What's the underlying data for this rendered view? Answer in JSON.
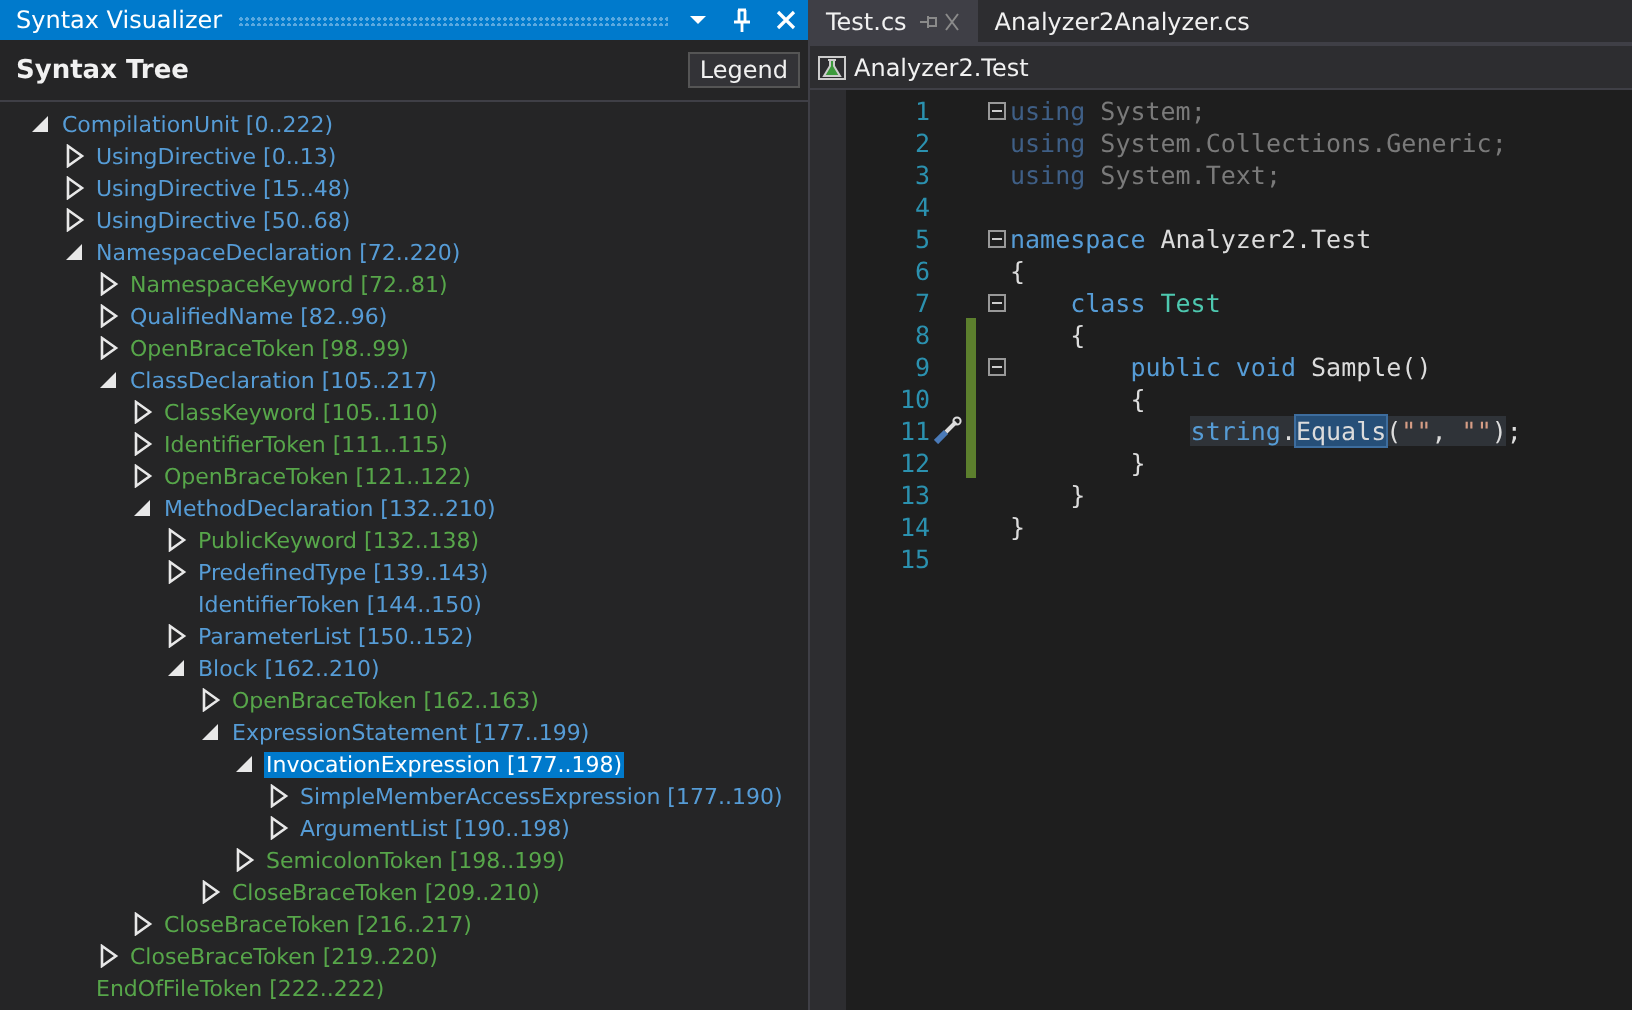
{
  "tool_window": {
    "title": "Syntax Visualizer",
    "header": "Syntax Tree",
    "legend_button": "Legend",
    "tree": [
      {
        "label": "CompilationUnit [0..222)",
        "kind": "node",
        "expanded": true,
        "selected": false,
        "children": [
          {
            "label": "UsingDirective [0..13)",
            "kind": "node",
            "selected": false
          },
          {
            "label": "UsingDirective [15..48)",
            "kind": "node",
            "selected": false
          },
          {
            "label": "UsingDirective [50..68)",
            "kind": "node",
            "selected": false
          },
          {
            "label": "NamespaceDeclaration [72..220)",
            "kind": "node",
            "expanded": true,
            "selected": false,
            "children": [
              {
                "label": "NamespaceKeyword [72..81)",
                "kind": "token",
                "selected": false
              },
              {
                "label": "QualifiedName [82..96)",
                "kind": "node",
                "selected": false
              },
              {
                "label": "OpenBraceToken [98..99)",
                "kind": "token",
                "selected": false
              },
              {
                "label": "ClassDeclaration [105..217)",
                "kind": "node",
                "expanded": true,
                "selected": false,
                "children": [
                  {
                    "label": "ClassKeyword [105..110)",
                    "kind": "token",
                    "selected": false
                  },
                  {
                    "label": "IdentifierToken [111..115)",
                    "kind": "token",
                    "selected": false
                  },
                  {
                    "label": "OpenBraceToken [121..122)",
                    "kind": "token",
                    "selected": false
                  },
                  {
                    "label": "MethodDeclaration [132..210)",
                    "kind": "node",
                    "expanded": true,
                    "selected": false,
                    "children": [
                      {
                        "label": "PublicKeyword [132..138)",
                        "kind": "token",
                        "selected": false
                      },
                      {
                        "label": "PredefinedType [139..143)",
                        "kind": "node",
                        "selected": false
                      },
                      {
                        "label": "IdentifierToken [144..150)",
                        "kind": "leaf",
                        "selected": false
                      },
                      {
                        "label": "ParameterList [150..152)",
                        "kind": "node",
                        "selected": false
                      },
                      {
                        "label": "Block [162..210)",
                        "kind": "node",
                        "expanded": true,
                        "selected": false,
                        "children": [
                          {
                            "label": "OpenBraceToken [162..163)",
                            "kind": "token",
                            "selected": false
                          },
                          {
                            "label": "ExpressionStatement [177..199)",
                            "kind": "node",
                            "expanded": true,
                            "selected": false,
                            "children": [
                              {
                                "label": "InvocationExpression [177..198)",
                                "kind": "node",
                                "expanded": true,
                                "selected": true,
                                "children": [
                                  {
                                    "label": "SimpleMemberAccessExpression [177..190)",
                                    "kind": "node",
                                    "selected": false
                                  },
                                  {
                                    "label": "ArgumentList [190..198)",
                                    "kind": "node",
                                    "selected": false
                                  }
                                ]
                              },
                              {
                                "label": "SemicolonToken [198..199)",
                                "kind": "token",
                                "selected": false
                              }
                            ]
                          },
                          {
                            "label": "CloseBraceToken [209..210)",
                            "kind": "token",
                            "selected": false
                          }
                        ]
                      }
                    ]
                  },
                  {
                    "label": "CloseBraceToken [216..217)",
                    "kind": "token",
                    "selected": false
                  }
                ]
              },
              {
                "label": "CloseBraceToken [219..220)",
                "kind": "token",
                "selected": false
              }
            ]
          },
          {
            "label": "EndOfFileToken [222..222)",
            "kind": "leaf-token",
            "selected": false
          }
        ]
      }
    ]
  },
  "editor": {
    "tabs": [
      {
        "label": "Test.cs",
        "selected": true
      },
      {
        "label": "Analyzer2Analyzer.cs",
        "selected": false
      }
    ],
    "navigation": "Analyzer2.Test",
    "lines": [
      {
        "number": "1",
        "fold": true,
        "changed": false,
        "quick_action": false,
        "tokens": [
          {
            "text": "using",
            "kind": "unused-keyword"
          },
          {
            "text": " System;",
            "kind": "unused"
          }
        ]
      },
      {
        "number": "2",
        "fold": false,
        "changed": false,
        "quick_action": false,
        "tokens": [
          {
            "text": "using",
            "kind": "unused-keyword"
          },
          {
            "text": " System.Collections.Generic;",
            "kind": "unused"
          }
        ]
      },
      {
        "number": "3",
        "fold": false,
        "changed": false,
        "quick_action": false,
        "tokens": [
          {
            "text": "using",
            "kind": "unused-keyword"
          },
          {
            "text": " System.Text;",
            "kind": "unused"
          }
        ]
      },
      {
        "number": "4",
        "fold": false,
        "changed": false,
        "quick_action": false
      },
      {
        "number": "5",
        "fold": true,
        "changed": false,
        "quick_action": false,
        "tokens": [
          {
            "text": "namespace",
            "kind": "keyword"
          },
          {
            "text": " Analyzer2.Test",
            "kind": "plain"
          }
        ]
      },
      {
        "number": "6",
        "fold": false,
        "changed": false,
        "quick_action": false,
        "tokens": [
          {
            "text": "{",
            "kind": "punct"
          }
        ]
      },
      {
        "number": "7",
        "fold": true,
        "changed": false,
        "quick_action": false,
        "tokens": [
          {
            "text": "class",
            "kind": "keyword"
          },
          {
            "text": " Test",
            "kind": "type"
          }
        ]
      },
      {
        "number": "8",
        "fold": false,
        "changed": true,
        "quick_action": false,
        "tokens": [
          {
            "text": "{",
            "kind": "punct"
          }
        ]
      },
      {
        "number": "9",
        "fold": true,
        "changed": true,
        "quick_action": false,
        "tokens": [
          {
            "text": "public void",
            "kind": "keyword"
          },
          {
            "text": " Sample()",
            "kind": "plain"
          }
        ]
      },
      {
        "number": "10",
        "fold": false,
        "changed": true,
        "quick_action": false,
        "tokens": [
          {
            "text": "{",
            "kind": "punct"
          }
        ]
      },
      {
        "number": "11",
        "fold": false,
        "changed": true,
        "quick_action": true,
        "tokens": [
          {
            "text": "string",
            "kind": "keyword-hl"
          },
          {
            "text": ".",
            "kind": "plain-hl"
          },
          {
            "text": "Equals",
            "kind": "reference"
          },
          {
            "text": "(",
            "kind": "plain-hl"
          },
          {
            "text": "\"\"",
            "kind": "string-hl"
          },
          {
            "text": ", ",
            "kind": "plain-hl"
          },
          {
            "text": "\"\"",
            "kind": "string-hl"
          },
          {
            "text": ")",
            "kind": "plain-hl"
          },
          {
            "text": ";",
            "kind": "plain"
          }
        ]
      },
      {
        "number": "12",
        "fold": false,
        "changed": true,
        "quick_action": false,
        "tokens": [
          {
            "text": "}",
            "kind": "punct"
          }
        ]
      },
      {
        "number": "13",
        "fold": false,
        "changed": false,
        "quick_action": false,
        "tokens": [
          {
            "text": "}",
            "kind": "punct"
          }
        ]
      },
      {
        "number": "14",
        "fold": false,
        "changed": false,
        "quick_action": false,
        "tokens": [
          {
            "text": "}",
            "kind": "punct"
          }
        ]
      },
      {
        "number": "15",
        "fold": false,
        "changed": false,
        "quick_action": false
      }
    ]
  }
}
